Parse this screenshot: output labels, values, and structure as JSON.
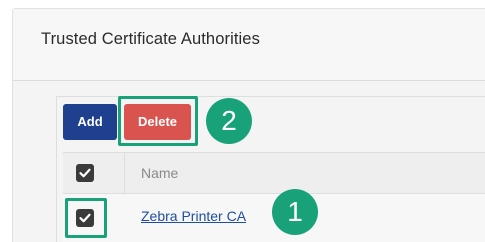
{
  "section": {
    "title": "Trusted Certificate Authorities"
  },
  "toolbar": {
    "add_label": "Add",
    "delete_label": "Delete"
  },
  "table": {
    "columns": [
      "Name"
    ],
    "rows": [
      {
        "name": "Zebra Printer CA",
        "selected": true
      }
    ],
    "select_all_checked": true
  },
  "callouts": {
    "step_delete": "2",
    "step_select": "1"
  },
  "colors": {
    "add_button": "#1f3f8f",
    "delete_button": "#d9534f",
    "callout_green": "#19a27a",
    "link": "#1f4ea1"
  },
  "icons": {
    "checkbox": "checkmark-icon"
  }
}
